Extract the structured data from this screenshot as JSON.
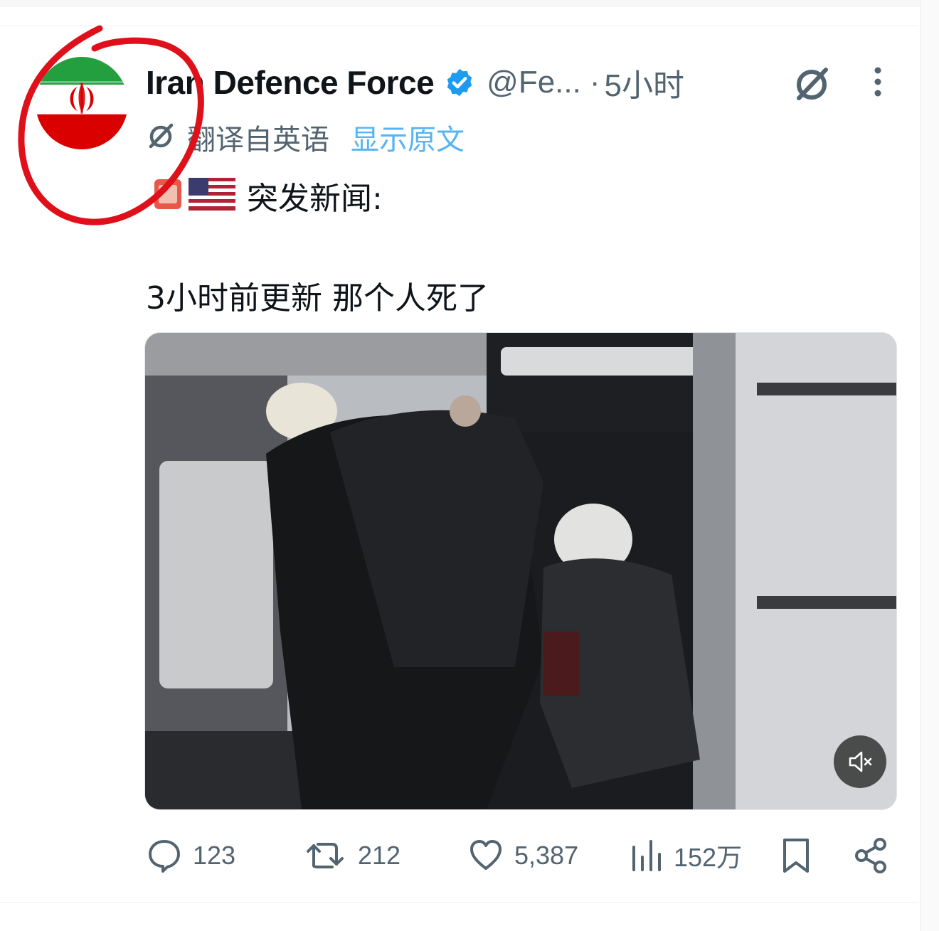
{
  "post": {
    "author": {
      "display_name": "Iran Defence Force",
      "handle": "@Fe...",
      "verified": true,
      "avatar": "iran-flag"
    },
    "separator": "·",
    "timestamp": "5小时",
    "translation": {
      "label": "翻译自英语",
      "show_original": "显示原文"
    },
    "headline": "突发新闻:",
    "headline_emojis": [
      "alert-emoji",
      "us-flag-emoji"
    ],
    "body": "3小时前更新 那个人死了",
    "media": {
      "type": "video",
      "muted": true
    },
    "stats": {
      "replies": "123",
      "reposts": "212",
      "likes": "5,387",
      "views": "152万"
    }
  },
  "icons": {
    "reply": "comment-icon",
    "repost": "repost-icon",
    "like": "heart-icon",
    "views": "analytics-icon",
    "bookmark": "bookmark-icon",
    "share": "share-icon",
    "grok": "grok-icon",
    "more": "more-icon",
    "mute": "mute-icon"
  },
  "colors": {
    "text": "#0f1419",
    "secondary": "#536471",
    "link": "#1d9bf0",
    "verified": "#1d9bf0",
    "annotation": "#e0101b"
  }
}
